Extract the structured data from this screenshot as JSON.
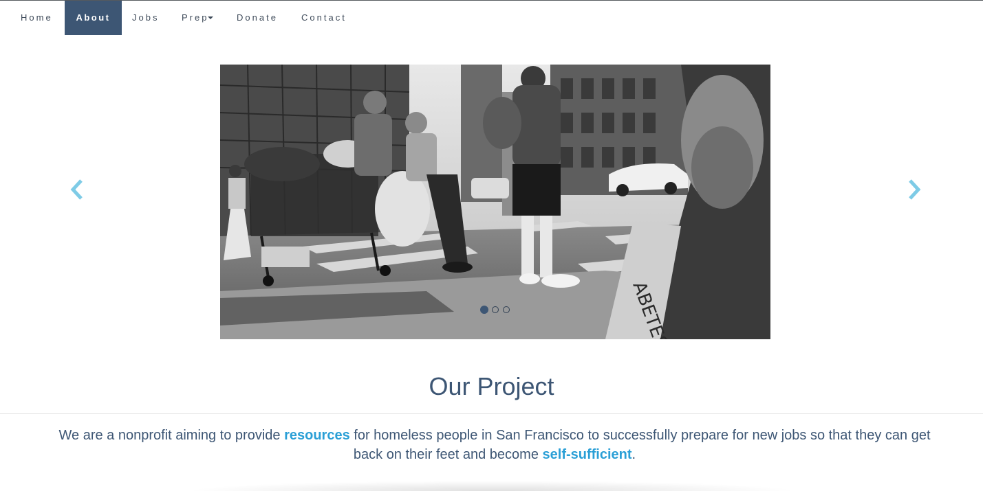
{
  "nav": {
    "items": [
      {
        "label": "Home"
      },
      {
        "label": "About"
      },
      {
        "label": "Jobs"
      },
      {
        "label": "Prep"
      },
      {
        "label": "Donate"
      },
      {
        "label": "Contact"
      }
    ],
    "active": "About"
  },
  "carousel": {
    "prev_icon": "chevron-left-icon",
    "next_icon": "chevron-right-icon",
    "slide_count": 3,
    "active_slide": 1,
    "arrow_color": "#7ecbe6"
  },
  "section": {
    "title": "Our Project",
    "description_parts": {
      "p1": "We are a nonprofit aiming to provide ",
      "h1": "resources",
      "p2": " for homeless people in San Francisco to successfully prepare for new jobs so that they can get back on their feet and become ",
      "h2": "self-sufficient",
      "p3": "."
    }
  },
  "colors": {
    "brand": "#3d5674",
    "accent": "#2a9fd6"
  }
}
